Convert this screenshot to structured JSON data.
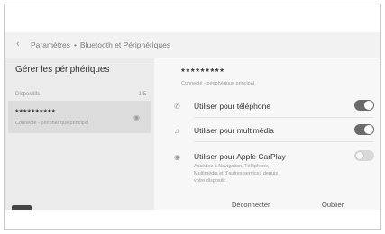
{
  "header": {
    "back_icon": "chevron-left-icon",
    "breadcrumb_parent": "Paramètres",
    "breadcrumb_separator": "•",
    "breadcrumb_current": "Bluetooth et Périphériques"
  },
  "left": {
    "title": "Gérer les périphériques",
    "list_label": "Dispositifs",
    "list_count": "1/5",
    "devices": [
      {
        "name": "**********",
        "subtitle": "Connecté - périphérique principal"
      }
    ],
    "voice_icon": "microphone-icon"
  },
  "detail": {
    "device_name": "*********",
    "status": "Connecté - périphérique principal",
    "options": [
      {
        "icon": "phone-icon",
        "label": "Utiliser pour téléphone",
        "enabled": true
      },
      {
        "icon": "music-note-icon",
        "label": "Utiliser pour multimédia",
        "enabled": true
      },
      {
        "icon": "carplay-icon",
        "label": "Utiliser pour Apple CarPlay",
        "enabled": false,
        "description": "Accédez à Navigation, Téléphone, Multimédia et d'autres services depuis votre dispositif."
      }
    ],
    "disconnect_label": "Déconnecter",
    "forget_label": "Oublier"
  },
  "colors": {
    "toggle_on": "#6a6a6a",
    "toggle_off": "#d9d9d9"
  }
}
